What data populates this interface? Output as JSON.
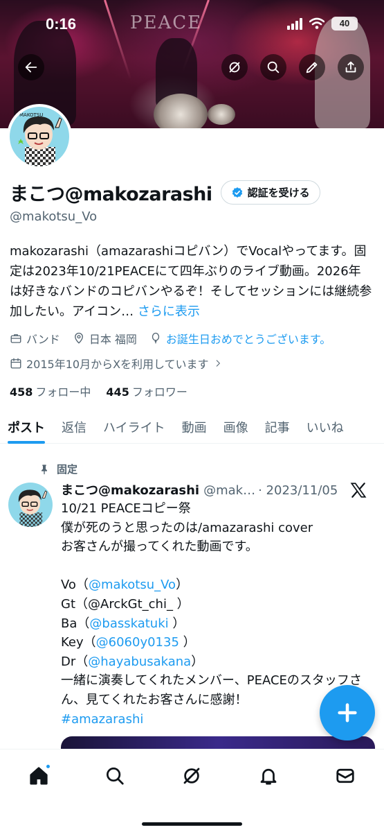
{
  "status_bar": {
    "time": "0:16",
    "battery": "40"
  },
  "banner": {
    "venue_sign": "PEACE"
  },
  "header_actions": {
    "back": "arrow-left-icon",
    "grok": "grok-icon",
    "search": "search-icon",
    "edit": "pencil-icon",
    "share": "share-icon"
  },
  "profile": {
    "display_name": "まこつ@makozarashi",
    "verify_label": "認証を受ける",
    "handle": "@makotsu_Vo",
    "bio": "makozarashi（amazarashiコピバン）でVocalやってます。固定は2023年10/21PEACEにて四年ぶりのライブ動画。2026年は好きなバンドのコピバンやるぞ！そしてセッションには継続参加したい。アイコン… ",
    "bio_more": "さらに表示",
    "category": "バンド",
    "location": "日本 福岡",
    "birthday": "お誕生日おめでとうございます。",
    "joined": "2015年10月からXを利用しています",
    "following_count": "458",
    "following_label": "フォロー中",
    "followers_count": "445",
    "followers_label": "フォロワー"
  },
  "tabs": [
    {
      "label": "ポスト",
      "active": true
    },
    {
      "label": "返信",
      "active": false
    },
    {
      "label": "ハイライト",
      "active": false
    },
    {
      "label": "動画",
      "active": false
    },
    {
      "label": "画像",
      "active": false
    },
    {
      "label": "記事",
      "active": false
    },
    {
      "label": "いいね",
      "active": false
    }
  ],
  "pinned_tweet": {
    "pinned_label": "固定",
    "author_name": "まこつ@makozarashi",
    "author_handle": "@mak…",
    "date": "· 2023/11/05",
    "line1": "10/21  PEACEコピー祭",
    "line2": "僕が死のうと思ったのは/amazarashi cover",
    "line3": "お客さんが撮ってくれた動画です。",
    "vo_prefix": "Vo（",
    "vo_mention": "@makotsu_Vo",
    "vo_suffix": "）",
    "gt_line": "Gt（@ArckGt_chi_ ）",
    "ba_prefix": "Ba（",
    "ba_mention": "@basskatuki",
    "ba_suffix": " ）",
    "key_prefix": "Key（",
    "key_mention": "@6060y0135",
    "key_suffix": " ）",
    "dr_prefix": "Dr（",
    "dr_mention": "@hayabusakana",
    "dr_suffix": "）",
    "thanks": "一緒に演奏してくれたメンバー、PEACEのスタッフさん、見てくれたお客さんに感謝！",
    "hashtag": "#amazarashi"
  },
  "bottom_nav": [
    "home-icon",
    "search-icon",
    "grok-icon",
    "bell-icon",
    "mail-icon"
  ],
  "colors": {
    "accent": "#1d9bf0",
    "text": "#0f1419",
    "secondary": "#536471"
  }
}
